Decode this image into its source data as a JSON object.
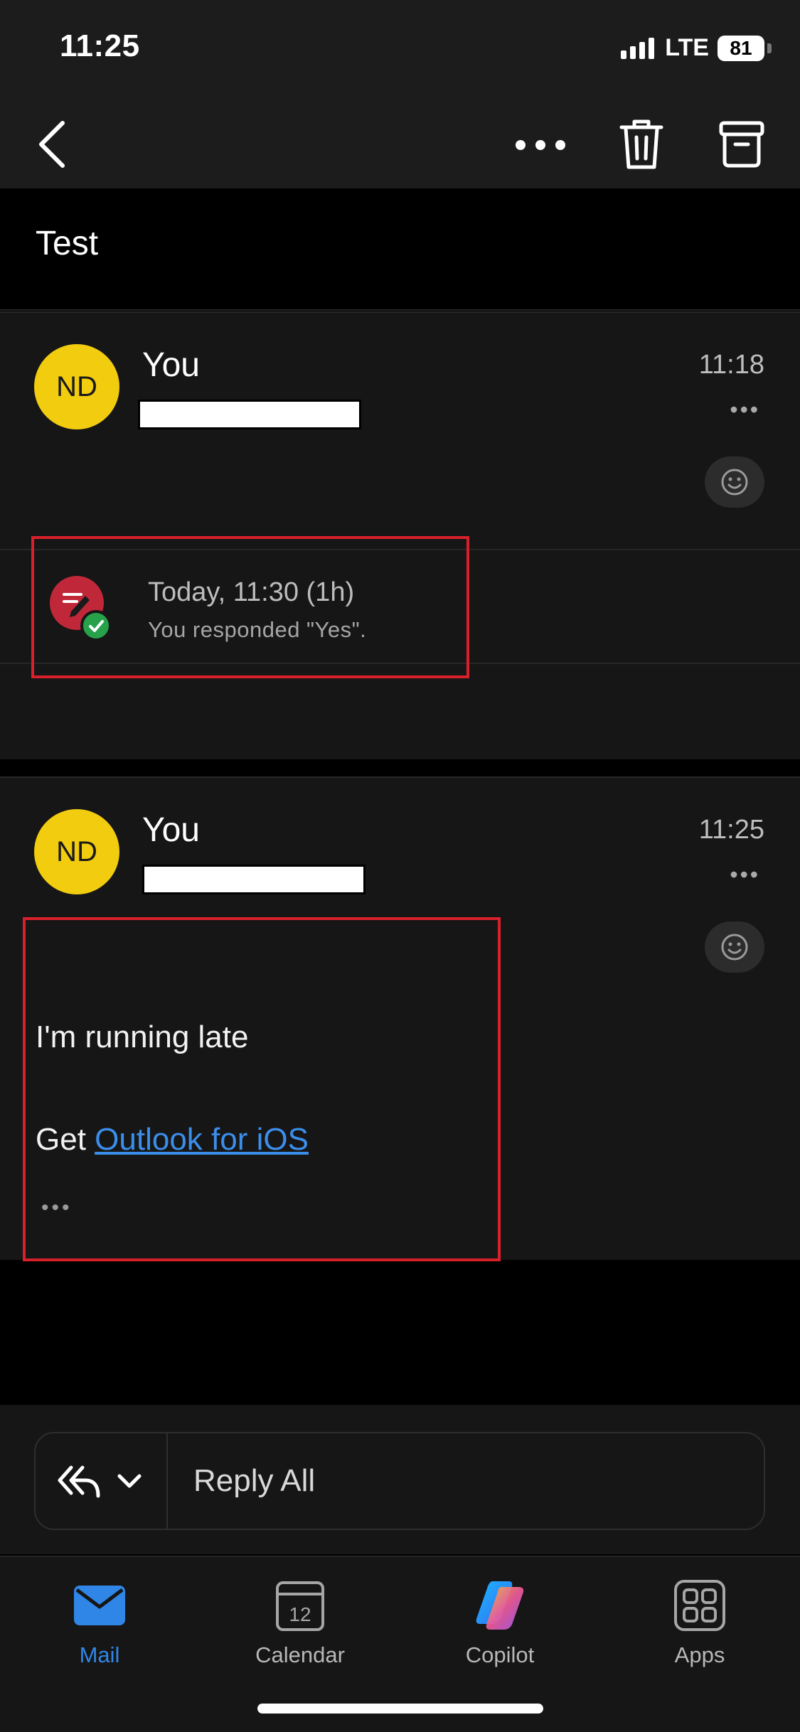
{
  "status_bar": {
    "time": "11:25",
    "network": "LTE",
    "battery": "81"
  },
  "nav": {
    "back_icon": "chevron-left-icon",
    "more_icon": "ellipsis-icon",
    "delete_icon": "trash-icon",
    "archive_icon": "archive-icon"
  },
  "thread": {
    "subject": "Test"
  },
  "messages": [
    {
      "avatar_initials": "ND",
      "avatar_color": "#f2cc0f",
      "sender": "You",
      "time": "11:18",
      "more": "•••",
      "invite": {
        "title": "Today, 11:30 (1h)",
        "status": "You responded \"Yes\"."
      }
    },
    {
      "avatar_initials": "ND",
      "avatar_color": "#f2cc0f",
      "sender": "You",
      "time": "11:25",
      "more": "•••",
      "body_line": "I'm running late",
      "signature_prefix": "Get ",
      "signature_link": "Outlook for iOS",
      "trimmed_indicator": "•••"
    }
  ],
  "reply": {
    "label": "Reply All"
  },
  "tabs": [
    {
      "label": "Mail",
      "active": true
    },
    {
      "label": "Calendar",
      "calendar_day": "12"
    },
    {
      "label": "Copilot"
    },
    {
      "label": "Apps"
    }
  ],
  "colors": {
    "accent": "#2f86e6",
    "highlight": "#d8202b",
    "invite": "#c0283a",
    "accepted": "#27a14a"
  }
}
